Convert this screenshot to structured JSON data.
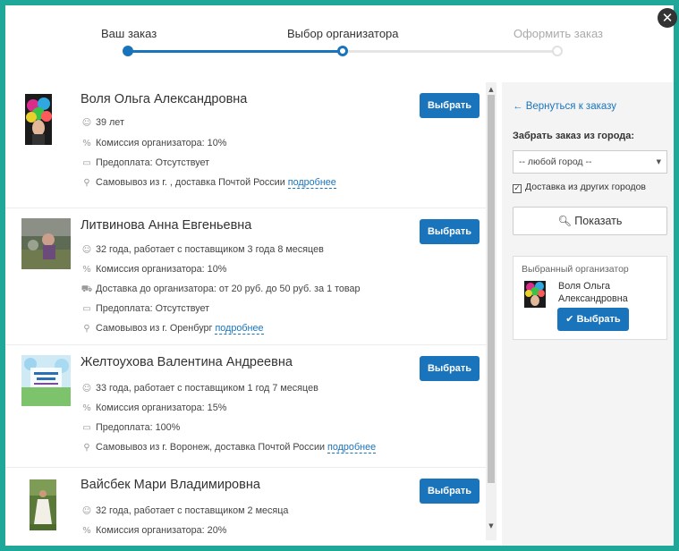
{
  "close_glyph": "✕",
  "stepper": {
    "steps": [
      {
        "label": "Ваш заказ",
        "state": "done"
      },
      {
        "label": "Выбор организатора",
        "state": "current"
      },
      {
        "label": "Оформить заказ",
        "state": "todo"
      }
    ]
  },
  "organizers": [
    {
      "name": "Воля Ольга Александровна",
      "button": "Выбрать",
      "details": [
        {
          "icon": "person-icon",
          "text": "39 лет"
        },
        {
          "icon": "percent-icon",
          "text": "Комиссия организатора: 10%"
        },
        {
          "icon": "card-icon",
          "text": "Предоплата: Отсутствует"
        },
        {
          "icon": "pin-icon",
          "text": "Самовывоз из г. , доставка Почтой России",
          "link": "подробнее"
        }
      ]
    },
    {
      "name": "Литвинова Анна Евгеньевна",
      "button": "Выбрать",
      "details": [
        {
          "icon": "person-icon",
          "text": "32 года, работает с поставщиком 3 года 8 месяцев"
        },
        {
          "icon": "percent-icon",
          "text": "Комиссия организатора: 10%"
        },
        {
          "icon": "truck-icon",
          "text": "Доставка до организатора: от 20 руб. до 50 руб. за 1 товар"
        },
        {
          "icon": "card-icon",
          "text": "Предоплата: Отсутствует"
        },
        {
          "icon": "pin-icon",
          "text": "Самовывоз из г. Оренбург",
          "link": "подробнее"
        }
      ]
    },
    {
      "name": "Желтоухова Валентина Андреевна",
      "button": "Выбрать",
      "details": [
        {
          "icon": "person-icon",
          "text": "33 года, работает с поставщиком 1 год 7 месяцев"
        },
        {
          "icon": "percent-icon",
          "text": "Комиссия организатора: 15%"
        },
        {
          "icon": "card-icon",
          "text": "Предоплата: 100%"
        },
        {
          "icon": "pin-icon",
          "text": "Самовывоз из г. Воронеж, доставка Почтой России",
          "link": "подробнее"
        }
      ]
    },
    {
      "name": "Вайсбек Мари Владимировна",
      "button": "Выбрать",
      "details": [
        {
          "icon": "person-icon",
          "text": "32 года, работает с поставщиком 2 месяца"
        },
        {
          "icon": "percent-icon",
          "text": "Комиссия организатора: 20%"
        }
      ]
    }
  ],
  "sidebar": {
    "back_link": "← Вернуться к заказу",
    "city_label": "Забрать заказ из города:",
    "city_select_value": "-- любой город --",
    "checkbox_label": "Доставка из других городов",
    "checkbox_checked": true,
    "show_button": "Показать",
    "chosen_title": "Выбранный организатор",
    "chosen_name": "Воля Ольга Александровна",
    "chosen_button": "Выбрать"
  },
  "colors": {
    "accent": "#1a74bb",
    "frame": "#1fa79a"
  }
}
